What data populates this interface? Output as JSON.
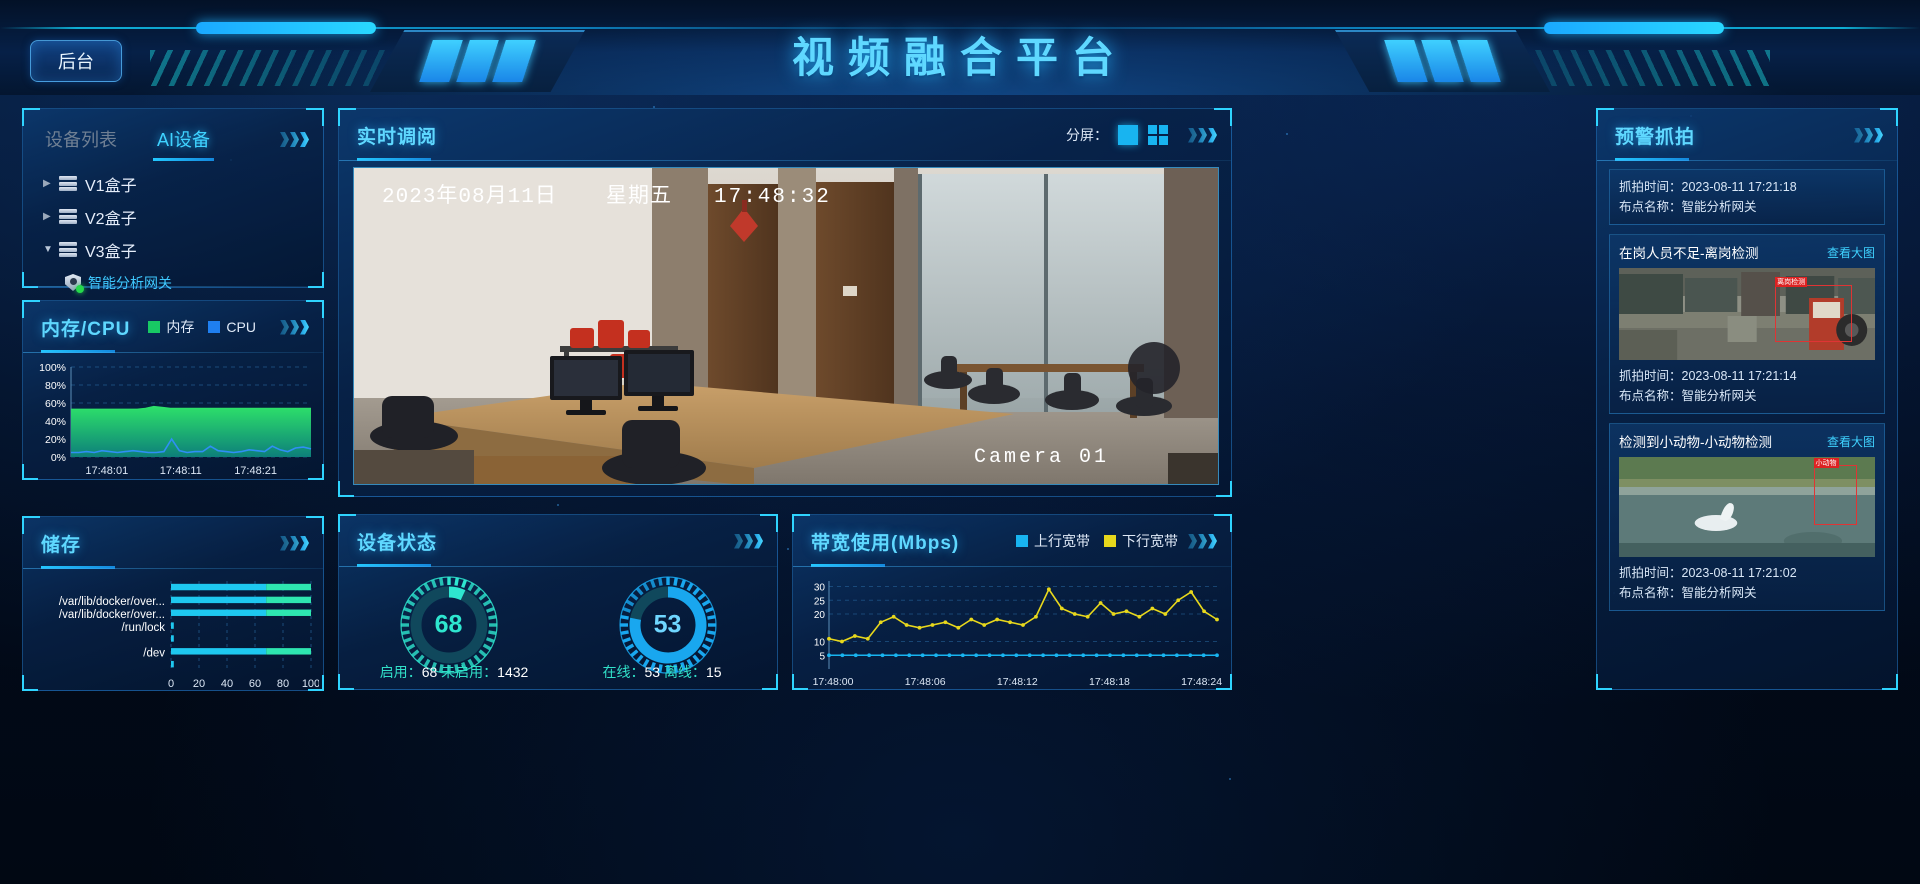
{
  "header": {
    "title": "视频融合平台",
    "backend_button": "后台"
  },
  "device_panel": {
    "tab_inactive": "设备列表",
    "tab_active": "AI设备",
    "tree": [
      {
        "label": "V1盒子",
        "expanded": false,
        "icon": "server-icon"
      },
      {
        "label": "V2盒子",
        "expanded": false,
        "icon": "server-icon"
      },
      {
        "label": "V3盒子",
        "expanded": true,
        "icon": "server-icon"
      },
      {
        "label": "智能分析网关",
        "child": true,
        "icon": "shield-icon",
        "status": "online"
      }
    ]
  },
  "memory_panel": {
    "title": "内存/CPU",
    "legend": [
      {
        "label": "内存",
        "color": "#18c964"
      },
      {
        "label": "CPU",
        "color": "#1f7ff0"
      }
    ]
  },
  "storage_panel": {
    "title": "储存"
  },
  "live_panel": {
    "title": "实时调阅",
    "split_label": "分屏：",
    "split_options": [
      "single",
      "quad"
    ],
    "video_osd_date": "2023年08月11日     星期五     17:48:32",
    "video_osd_camera": "Camera 01"
  },
  "status_panel": {
    "title": "设备状态",
    "gauges": [
      {
        "value": 68,
        "color": "#2ee6cf",
        "footer_label_1": "启用：",
        "footer_value_1": "68",
        "footer_label_2": "未启用：",
        "footer_value_2": "1432"
      },
      {
        "value": 53,
        "color": "#19a7ef",
        "footer_label_1": "在线：",
        "footer_value_1": "53",
        "footer_label_2": "离线：",
        "footer_value_2": "15"
      }
    ]
  },
  "bandwidth_panel": {
    "title": "带宽使用(Mbps)",
    "legend": [
      {
        "label": "上行宽带",
        "color": "#18b4f0"
      },
      {
        "label": "下行宽带",
        "color": "#e8d81c"
      }
    ]
  },
  "alert_panel": {
    "title": "预警抓拍",
    "cards": [
      {
        "time_label": "抓拍时间：",
        "time_value": "2023-08-11 17:21:18",
        "place_label": "布点名称：",
        "place_value": "智能分析网关",
        "has_image": false
      },
      {
        "event_title": "在岗人员不足-离岗检测",
        "view_link": "查看大图",
        "time_label": "抓拍时间：",
        "time_value": "2023-08-11 17:21:14",
        "place_label": "布点名称：",
        "place_value": "智能分析网关",
        "has_image": true,
        "image_kind": "factory-floor",
        "bbox_tag": "离岗检测"
      },
      {
        "event_title": "检测到小动物-小动物检测",
        "view_link": "查看大图",
        "time_label": "抓拍时间：",
        "time_value": "2023-08-11 17:21:02",
        "place_label": "布点名称：",
        "place_value": "智能分析网关",
        "has_image": true,
        "image_kind": "lake-swan",
        "bbox_tag": "小动物"
      }
    ]
  },
  "chart_data": [
    {
      "id": "memory_cpu",
      "type": "area",
      "title": "内存/CPU",
      "xlabel": "",
      "ylabel": "%",
      "ylim": [
        0,
        100
      ],
      "yticks": [
        "0%",
        "20%",
        "40%",
        "60%",
        "80%",
        "100%"
      ],
      "x": [
        "17:48:01",
        "17:48:11",
        "17:48:21"
      ],
      "xtick_positions": [
        0.06,
        0.37,
        0.68
      ],
      "grid": true,
      "legend_position": "header-right",
      "series": [
        {
          "name": "内存",
          "color": "#18c964",
          "fill": true,
          "values": [
            53,
            53,
            53,
            53,
            53,
            53,
            53,
            53,
            53,
            54,
            56,
            55,
            54,
            54,
            54,
            54,
            54,
            54,
            54,
            54,
            54,
            54,
            54,
            54,
            54,
            54,
            54,
            54,
            54,
            54
          ]
        },
        {
          "name": "CPU",
          "color": "#1f7ff0",
          "fill": false,
          "values": [
            5,
            5,
            6,
            5,
            7,
            6,
            5,
            6,
            7,
            6,
            5,
            5,
            6,
            20,
            7,
            5,
            6,
            6,
            12,
            7,
            6,
            5,
            6,
            8,
            7,
            6,
            12,
            8,
            6,
            10,
            11,
            9
          ]
        }
      ]
    },
    {
      "id": "storage",
      "type": "bar",
      "orientation": "horizontal",
      "title": "储存",
      "categories": [
        "/var/lib/docker/over...",
        "/var/lib/docker/over...",
        "/run/lock",
        "/dev"
      ],
      "xlim": [
        0,
        100
      ],
      "xticks": [
        0,
        20,
        40,
        60,
        80,
        100
      ],
      "grid": true,
      "series": [
        {
          "name": "used",
          "color": "#1ec8f0",
          "values": [
            68,
            68,
            2,
            68
          ]
        },
        {
          "name": "free",
          "color": "#2ee6b0",
          "values": [
            32,
            32,
            0,
            32
          ]
        }
      ],
      "extra_rows": [
        {
          "color": "#1ec8f0",
          "value": 68
        },
        {
          "color": "#2ee6b0",
          "value": 2
        },
        {
          "color": "#2ee6b0",
          "value": 2
        }
      ]
    },
    {
      "id": "bandwidth",
      "type": "line",
      "title": "带宽使用(Mbps)",
      "ylim": [
        0,
        32
      ],
      "yticks": [
        5,
        10,
        20,
        25,
        30
      ],
      "x": [
        "17:48:00",
        "17:48:06",
        "17:48:12",
        "17:48:18",
        "17:48:24"
      ],
      "grid": true,
      "legend_position": "header-right",
      "series": [
        {
          "name": "上行宽带",
          "color": "#18b4f0",
          "values": [
            5,
            5,
            5,
            5,
            5,
            5,
            5,
            5,
            5,
            5,
            5,
            5,
            5,
            5,
            5,
            5,
            5,
            5,
            5,
            5,
            5,
            5,
            5,
            5,
            5,
            5,
            5,
            5,
            5,
            5
          ]
        },
        {
          "name": "下行宽带",
          "color": "#e8d81c",
          "values": [
            11,
            10,
            12,
            11,
            17,
            19,
            16,
            15,
            16,
            17,
            15,
            18,
            16,
            18,
            17,
            16,
            19,
            29,
            22,
            20,
            19,
            24,
            20,
            21,
            19,
            22,
            20,
            25,
            28,
            21,
            18
          ]
        }
      ]
    },
    {
      "id": "device_status_gauges",
      "type": "pie",
      "title": "设备状态",
      "gauges": [
        {
          "label": "启用",
          "value": 68,
          "total": 1500,
          "color": "#2ee6cf"
        },
        {
          "label": "在线",
          "value": 53,
          "total": 68,
          "color": "#19a7ef"
        }
      ]
    }
  ]
}
